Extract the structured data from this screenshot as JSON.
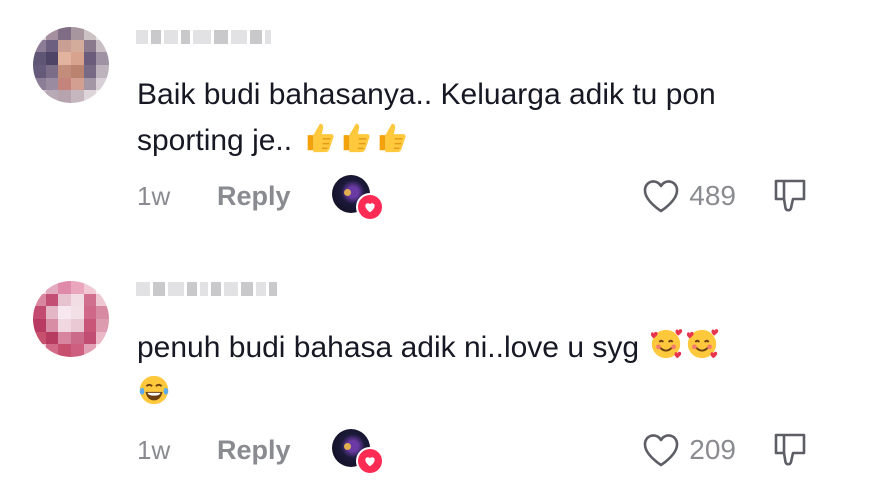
{
  "comments": [
    {
      "text": "Baik budi bahasanya.. Keluarga adik tu pon sporting je..",
      "emojis": [
        "thumbs-up",
        "thumbs-up",
        "thumbs-up"
      ],
      "time": "1w",
      "reply_label": "Reply",
      "likes": "489"
    },
    {
      "text": "penuh budi bahasa adik ni..love u syg",
      "emojis": [
        "smiling-face-with-hearts",
        "smiling-face-with-hearts",
        "tears-of-joy"
      ],
      "time": "1w",
      "reply_label": "Reply",
      "likes": "209"
    }
  ],
  "colors": {
    "text": "#161823",
    "secondary": "#8a8b91",
    "heart_badge": "#fe2c55"
  },
  "icons": [
    "avatar",
    "creator-liked-badge",
    "heart-outline-icon",
    "thumbs-down-outline-icon"
  ]
}
